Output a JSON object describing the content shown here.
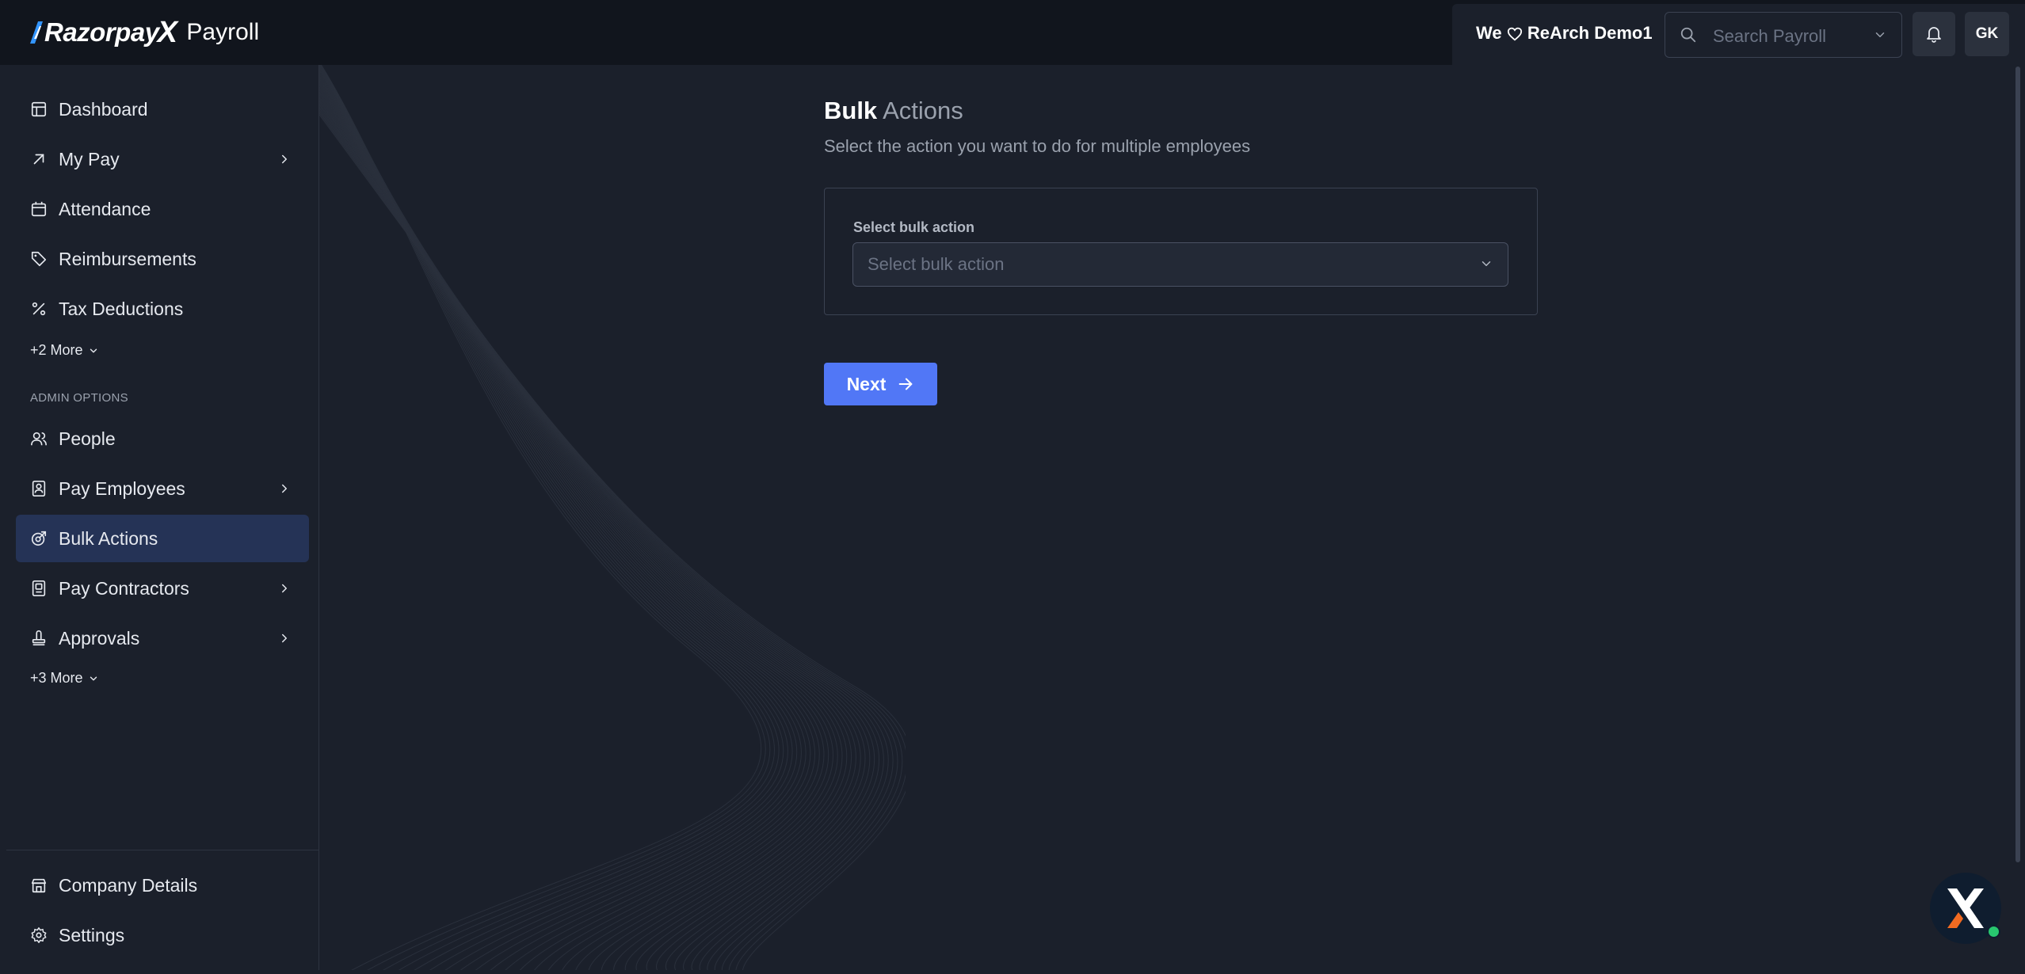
{
  "brand": {
    "logo_text": "Razorpay",
    "logo_x": "X",
    "product": "Payroll"
  },
  "header": {
    "org_prefix": "We",
    "org_name": "ReArch Demo1",
    "search_placeholder": "Search Payroll",
    "avatar_initials": "GK"
  },
  "sidebar": {
    "items": [
      {
        "label": "Dashboard",
        "icon": "dashboard-icon"
      },
      {
        "label": "My Pay",
        "icon": "arrow-up-right-icon"
      },
      {
        "label": "Attendance",
        "icon": "calendar-icon"
      },
      {
        "label": "Reimbursements",
        "icon": "tag-icon"
      },
      {
        "label": "Tax Deductions",
        "icon": "percent-icon"
      }
    ],
    "more_top": "+2 More",
    "section_label": "ADMIN OPTIONS",
    "admin_items": [
      {
        "label": "People",
        "icon": "people-icon"
      },
      {
        "label": "Pay Employees",
        "icon": "pay-employees-icon"
      },
      {
        "label": "Bulk Actions",
        "icon": "bulk-actions-icon"
      },
      {
        "label": "Pay Contractors",
        "icon": "pay-contractors-icon"
      },
      {
        "label": "Approvals",
        "icon": "approvals-icon"
      }
    ],
    "more_bottom": "+3 More",
    "footer_items": [
      {
        "label": "Company Details",
        "icon": "company-icon"
      },
      {
        "label": "Settings",
        "icon": "settings-icon"
      }
    ],
    "active": "Bulk Actions"
  },
  "main": {
    "title_strong": "Bulk",
    "title_weak": "Actions",
    "subtitle": "Select the action you want to do for multiple employees",
    "field_label": "Select bulk action",
    "select_placeholder": "Select bulk action",
    "next_button": "Next"
  },
  "colors": {
    "background": "#1b202b",
    "topbar": "#11151d",
    "accent": "#5177f6",
    "active_nav": "#253356",
    "fab_status": "#28c76f"
  }
}
